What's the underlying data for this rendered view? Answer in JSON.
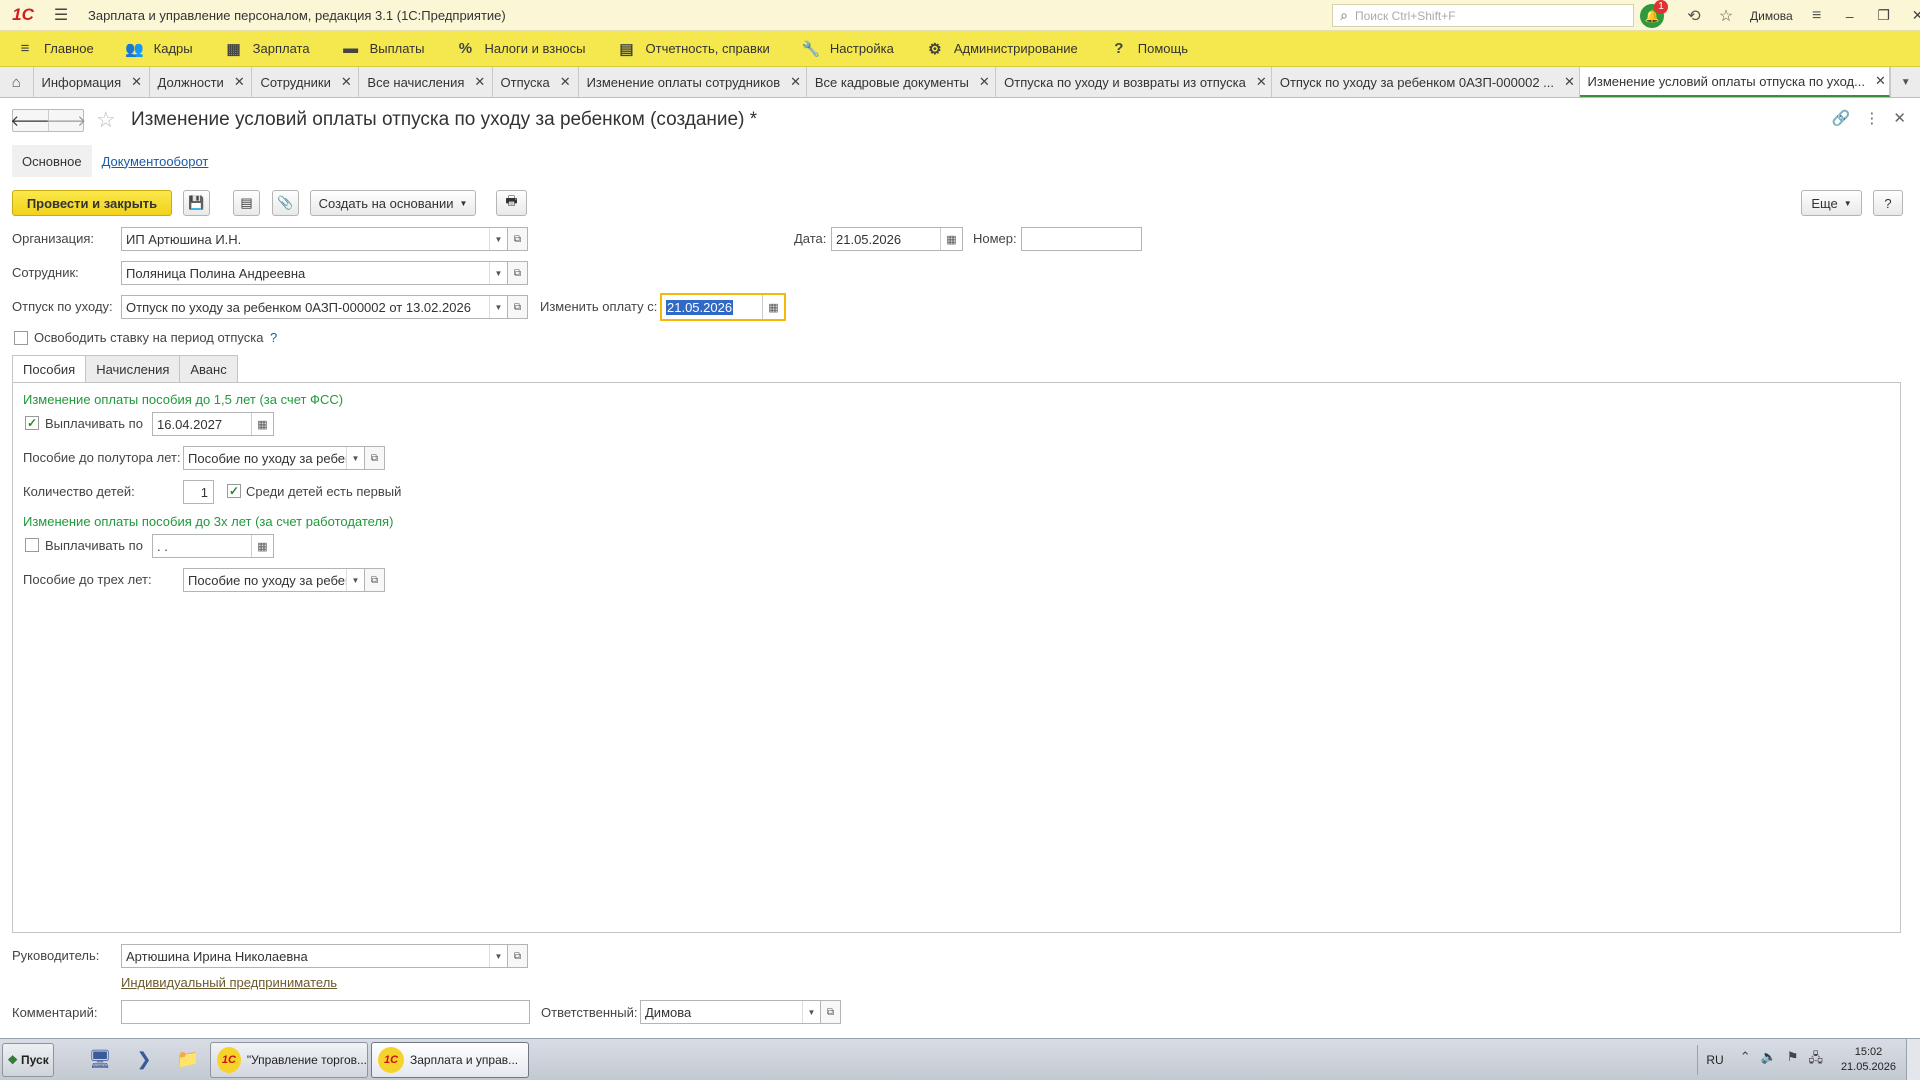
{
  "app": {
    "title": "Зарплата и управление персоналом, редакция 3.1  (1С:Предприятие)",
    "logo": "1С",
    "search_placeholder": "Поиск Ctrl+Shift+F",
    "notifications_count": "1",
    "user": "Димова"
  },
  "sections": [
    {
      "label": "Главное",
      "icon": "menu-icon"
    },
    {
      "label": "Кадры",
      "icon": "people-icon"
    },
    {
      "label": "Зарплата",
      "icon": "calculator-icon"
    },
    {
      "label": "Выплаты",
      "icon": "wallet-icon"
    },
    {
      "label": "Налоги и взносы",
      "icon": "percent-icon"
    },
    {
      "label": "Отчетность, справки",
      "icon": "reports-icon"
    },
    {
      "label": "Настройка",
      "icon": "wrench-icon"
    },
    {
      "label": "Администрирование",
      "icon": "gear-icon"
    },
    {
      "label": "Помощь",
      "icon": "question-icon"
    }
  ],
  "open_tabs": [
    {
      "label": "Информация"
    },
    {
      "label": "Должности"
    },
    {
      "label": "Сотрудники"
    },
    {
      "label": "Все начисления"
    },
    {
      "label": "Отпуска"
    },
    {
      "label": "Изменение оплаты сотрудников"
    },
    {
      "label": "Все кадровые документы"
    },
    {
      "label": "Отпуска по уходу и возвраты из отпуска"
    },
    {
      "label": "Отпуск по уходу за ребенком 0АЗП-000002 ..."
    },
    {
      "label": "Изменение условий оплаты отпуска по уход..."
    }
  ],
  "form": {
    "title": "Изменение условий оплаты отпуска по уходу за ребенком (создание) *",
    "link_tabs": [
      "Основное",
      "Документооборот"
    ],
    "toolbar": {
      "post_close": "Провести и закрыть",
      "create_based": "Создать на основании",
      "more": "Еще",
      "help": "?"
    },
    "organization_label": "Организация:",
    "organization": "ИП Артюшина И.Н.",
    "date_label": "Дата:",
    "date": "21.05.2026",
    "number_label": "Номер:",
    "number": "",
    "employee_label": "Сотрудник:",
    "employee": "Поляница Полина Андреевна",
    "leave_label": "Отпуск по уходу:",
    "leave": "Отпуск по уходу за ребенком 0АЗП-000002 от 13.02.2026",
    "change_from_label": "Изменить оплату с:",
    "change_from": "21.05.2026",
    "release_rate_label": "Освободить ставку на период отпуска",
    "release_rate_checked": false,
    "help_mark": "?",
    "inner_tabs": [
      "Пособия",
      "Начисления",
      "Аванс"
    ],
    "benefits": {
      "group1_title": "Изменение оплаты пособия до 1,5 лет (за счет ФСС)",
      "pay_until_label": "Выплачивать по",
      "pay_until_1_checked": true,
      "pay_until_1": "16.04.2027",
      "benefit_1_5_label": "Пособие до полутора лет:",
      "benefit_1_5": "Пособие по уходу за ребенком",
      "children_count_label": "Количество детей:",
      "children_count": "1",
      "first_child_label": "Среди детей есть первый",
      "first_child_checked": true,
      "group2_title": "Изменение оплаты пособия до 3х лет (за счет работодателя)",
      "pay_until_2_checked": false,
      "pay_until_2": " .  .",
      "benefit_3_label": "Пособие до трех лет:",
      "benefit_3": "Пособие по уходу за ребенком"
    },
    "manager_label": "Руководитель:",
    "manager": "Артюшина Ирина Николаевна",
    "manager_position": "Индивидуальный предприниматель",
    "comment_label": "Комментарий:",
    "comment": "",
    "responsible_label": "Ответственный:",
    "responsible": "Димова"
  },
  "taskbar": {
    "start": "Пуск",
    "tasks": [
      "\"Управление торгов...",
      "Зарплата и управ..."
    ],
    "lang": "RU",
    "time": "15:02",
    "date": "21.05.2026"
  },
  "colors": {
    "section_bar": "#f5e84e",
    "title_bar": "#fbf7d6",
    "primary_button": "#f1d21c",
    "group_title": "#1f9a3a",
    "focus_border": "#f2b90a"
  }
}
